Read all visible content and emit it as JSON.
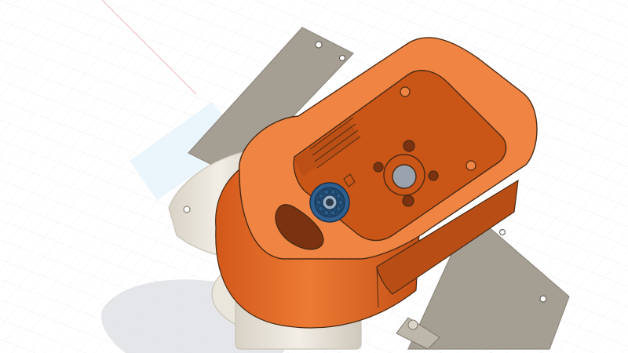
{
  "viewport": {
    "background": "#ffffff",
    "grid_color": "#e3e6ea",
    "axis_color": "#f2b8b8",
    "ground_shadow_color": "#dfe0e3",
    "xy_plane_color": "#e4f1fb"
  },
  "model": {
    "housing": {
      "body_color": "#e86a23",
      "top_face_color": "#f08543",
      "inner_color": "#c95517",
      "shadow_color": "#b84d16",
      "edge_color": "#4a2a14"
    },
    "bearing": {
      "ring_color": "#2f5f8f",
      "ball_color": "#2a5a86",
      "hub_color": "#9ab0c4"
    },
    "bracket": {
      "plate_color": "#a59e93",
      "plate_dark": "#8f887d",
      "mount_color": "#ebe6dc",
      "mount_edge": "#c9c2b6"
    }
  }
}
